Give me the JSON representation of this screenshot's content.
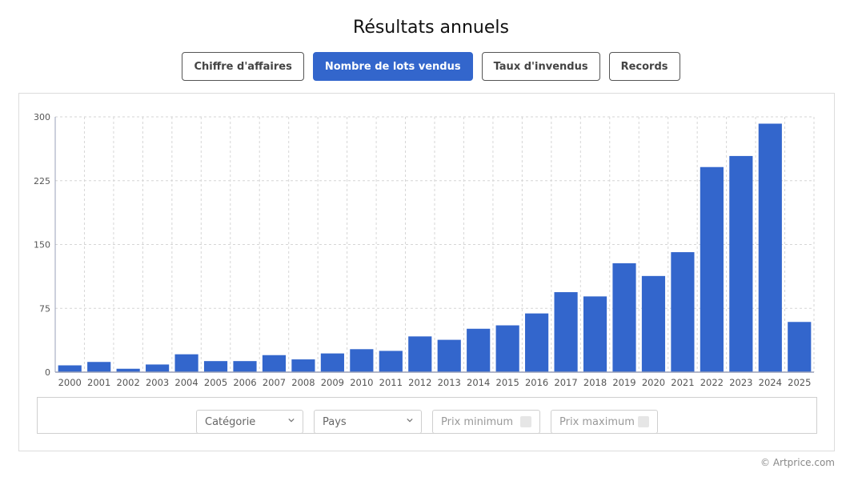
{
  "title": "Résultats annuels",
  "tabs": [
    {
      "label": "Chiffre d'affaires",
      "active": false
    },
    {
      "label": "Nombre de lots vendus",
      "active": true
    },
    {
      "label": "Taux d'invendus",
      "active": false
    },
    {
      "label": "Records",
      "active": false
    }
  ],
  "filters": {
    "category": "Catégorie",
    "country": "Pays",
    "min_price": "Prix minimum",
    "max_price": "Prix maximum"
  },
  "copyright": "© Artprice.com",
  "colors": {
    "bar": "#3366cc",
    "grid": "#d6d6d6",
    "axis": "#9aa0b8"
  },
  "chart_data": {
    "type": "bar",
    "categories": [
      "2000",
      "2001",
      "2002",
      "2003",
      "2004",
      "2005",
      "2006",
      "2007",
      "2008",
      "2009",
      "2010",
      "2011",
      "2012",
      "2013",
      "2014",
      "2015",
      "2016",
      "2017",
      "2018",
      "2019",
      "2020",
      "2021",
      "2022",
      "2023",
      "2024",
      "2025"
    ],
    "values": [
      8,
      12,
      4,
      9,
      21,
      13,
      13,
      20,
      15,
      22,
      27,
      25,
      42,
      38,
      51,
      55,
      69,
      94,
      89,
      128,
      113,
      141,
      241,
      254,
      292,
      59
    ],
    "yticks": [
      0,
      75,
      150,
      225,
      300
    ],
    "ylim": [
      0,
      300
    ],
    "grid": true
  }
}
